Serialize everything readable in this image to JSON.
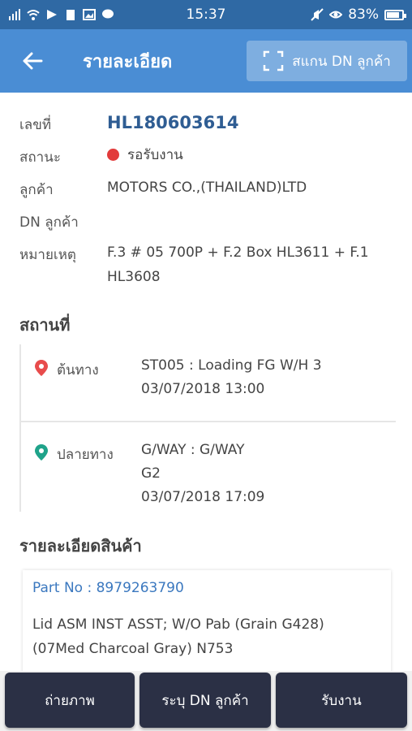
{
  "status_bar": {
    "time": "15:37",
    "battery": "83%",
    "battery_level": 0.83
  },
  "appbar": {
    "title": "รายละเอียด",
    "scan_button": "สแกน DN ลูกค้า"
  },
  "details": {
    "number_label": "เลขที่",
    "number_value": "HL180603614",
    "status_label": "สถานะ",
    "status_value": "รอรับงาน",
    "status_color": "#e23b3b",
    "customer_label": "ลูกค้า",
    "customer_value": "MOTORS CO.,(THAILAND)LTD",
    "dn_label": "DN ลูกค้า",
    "dn_value": "",
    "note_label": "หมายเหตุ",
    "note_line1": "F.3 # 05 700P + F.2 Box HL3611 + F.1",
    "note_line2": "HL3608"
  },
  "location": {
    "section_title": "สถานที่",
    "origin": {
      "label": "ต้นทาง",
      "line1": "ST005 : Loading FG W/H 3",
      "line2": "03/07/2018 13:00",
      "pin_color": "#e84c4c"
    },
    "destination": {
      "label": "ปลายทาง",
      "line1": "G/WAY : G/WAY",
      "line2": "G2",
      "line3": "03/07/2018 17:09",
      "pin_color": "#1fa38a"
    }
  },
  "product": {
    "section_title": "รายละเอียดสินค้า",
    "part_no": "Part No : 8979263790",
    "desc_line1": "Lid ASM INST ASST;  W/O Pab (Grain G428)",
    "desc_line2": "(07Med Charcoal Gray) N753"
  },
  "bottom_buttons": {
    "photo": "ถ่ายภาพ",
    "specify_dn": "ระบุ DN ลูกค้า",
    "accept": "รับงาน"
  },
  "colors": {
    "status_bar": "#2f69a4",
    "app_bar": "#4a8dd4",
    "accent_text": "#2f5d93",
    "button_dark": "#2b3045"
  }
}
